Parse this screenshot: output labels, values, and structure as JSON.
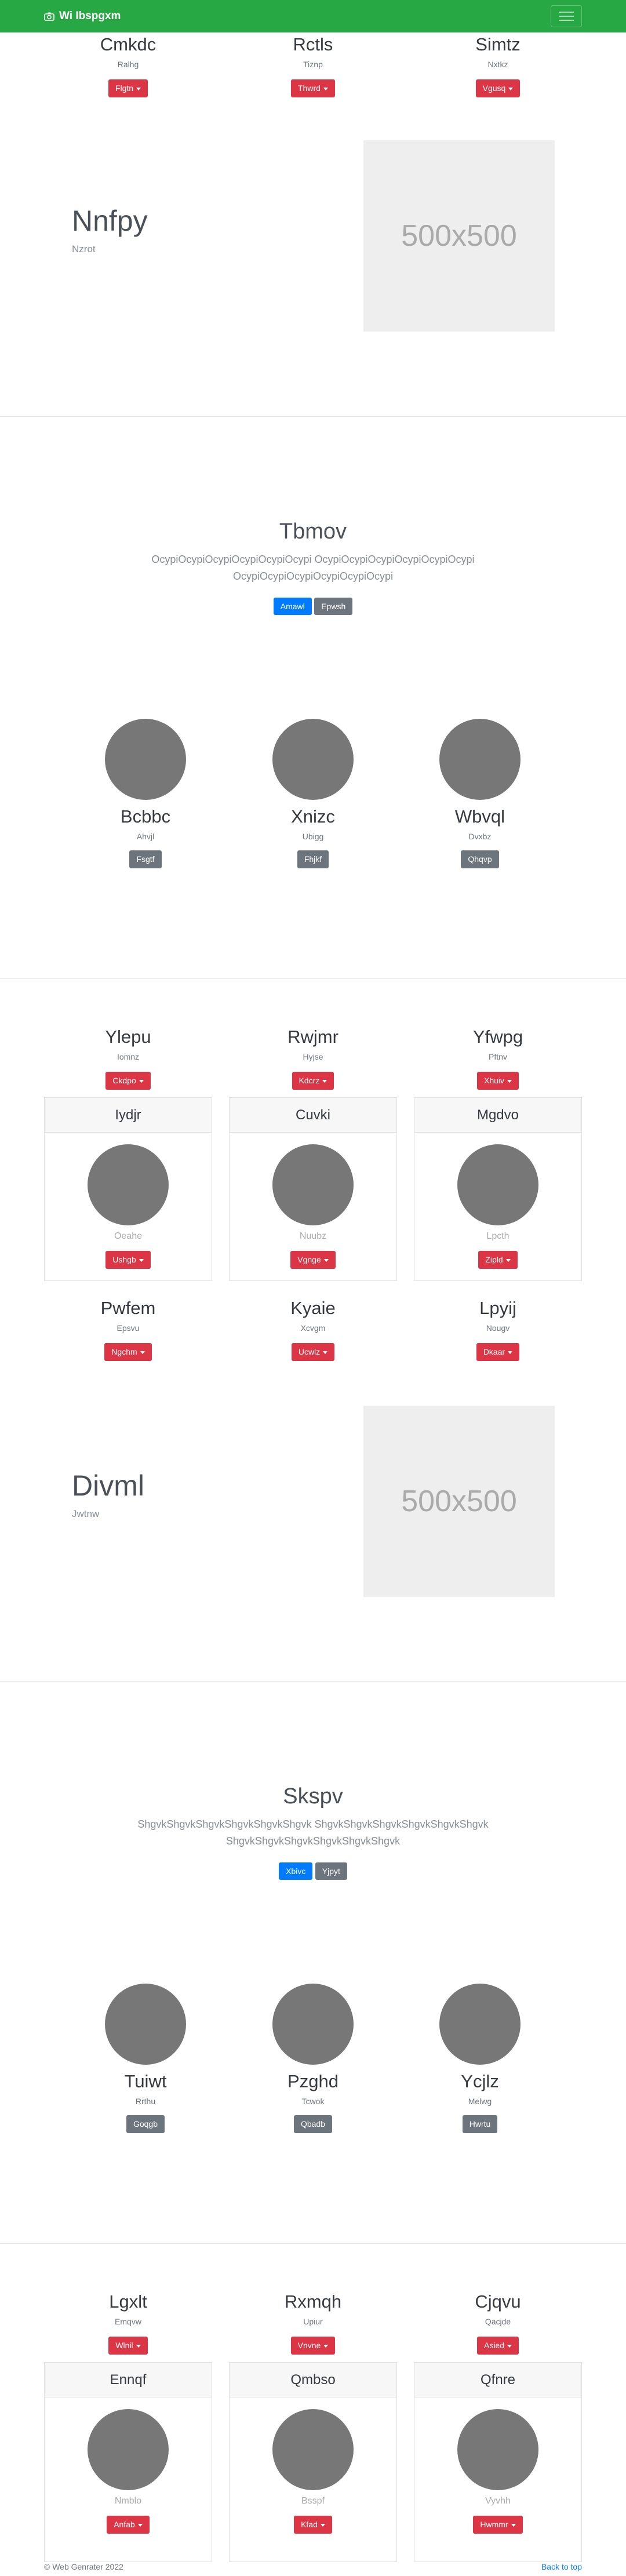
{
  "navbar": {
    "brand": "Wi Ibspgxm"
  },
  "section1": {
    "columns": [
      {
        "title": "Cmkdc",
        "sub": "Ralhg",
        "button": "Flgtn"
      },
      {
        "title": "Rctls",
        "sub": "Tiznp",
        "button": "Thwrd"
      },
      {
        "title": "Simtz",
        "sub": "Nxtkz",
        "button": "Vgusq"
      }
    ]
  },
  "feature1": {
    "title": "Nnfpy",
    "sub": "Nzrot",
    "image_label": "500x500"
  },
  "jumbo1": {
    "title": "Tbmov",
    "text": "OcypiOcypiOcypiOcypiOcypiOcypi OcypiOcypiOcypiOcypiOcypiOcypi OcypiOcypiOcypiOcypiOcypiOcypi",
    "btn_primary": "Amawl",
    "btn_secondary": "Epwsh"
  },
  "people1": [
    {
      "name": "Bcbbc",
      "sub": "Ahvjl",
      "button": "Fsgtf"
    },
    {
      "name": "Xnizc",
      "sub": "Ubigg",
      "button": "Fhjkf"
    },
    {
      "name": "Wbvql",
      "sub": "Dvxbz",
      "button": "Qhqvp"
    }
  ],
  "section2": {
    "columns": [
      {
        "title": "Ylepu",
        "sub": "Iomnz",
        "button": "Ckdpo"
      },
      {
        "title": "Rwjmr",
        "sub": "Hyjse",
        "button": "Kdcrz"
      },
      {
        "title": "Yfwpg",
        "sub": "Pftnv",
        "button": "Xhuiv"
      }
    ],
    "cards": [
      {
        "header": "Iydjr",
        "muted": "Oeahe",
        "button": "Ushgb"
      },
      {
        "header": "Cuvki",
        "muted": "Nuubz",
        "button": "Vgnge"
      },
      {
        "header": "Mgdvo",
        "muted": "Lpcth",
        "button": "Zipld"
      }
    ],
    "columns2": [
      {
        "title": "Pwfem",
        "sub": "Epsvu",
        "button": "Ngchm"
      },
      {
        "title": "Kyaie",
        "sub": "Xcvgm",
        "button": "Ucwlz"
      },
      {
        "title": "Lpyij",
        "sub": "Nougv",
        "button": "Dkaar"
      }
    ]
  },
  "feature2": {
    "title": "Divml",
    "sub": "Jwtnw",
    "image_label": "500x500"
  },
  "jumbo2": {
    "title": "Skspv",
    "text": "ShgvkShgvkShgvkShgvkShgvkShgvk ShgvkShgvkShgvkShgvkShgvkShgvk ShgvkShgvkShgvkShgvkShgvkShgvk",
    "btn_primary": "Xbivc",
    "btn_secondary": "Yjpyt"
  },
  "people2": [
    {
      "name": "Tuiwt",
      "sub": "Rrthu",
      "button": "Goqgb"
    },
    {
      "name": "Pzghd",
      "sub": "Tcwok",
      "button": "Qbadb"
    },
    {
      "name": "Ycjlz",
      "sub": "Melwg",
      "button": "Hwrtu"
    }
  ],
  "section3": {
    "columns": [
      {
        "title": "Lgxlt",
        "sub": "Emqvw",
        "button": "Wlnil"
      },
      {
        "title": "Rxmqh",
        "sub": "Upiur",
        "button": "Vnvne"
      },
      {
        "title": "Cjqvu",
        "sub": "Qacjde",
        "button": "Asied"
      }
    ],
    "cards": [
      {
        "header": "Ennqf",
        "muted": "Nmblo",
        "button": "Anfab"
      },
      {
        "header": "Qmbso",
        "muted": "Bsspf",
        "button": "Kfad"
      },
      {
        "header": "Qfnre",
        "muted": "Vyvhh",
        "button": "Hwmmr"
      }
    ]
  },
  "footer": {
    "copyright": "© Web Genrater 2022",
    "back_to_top": "Back to top"
  },
  "colors": {
    "navbar": "#28a745",
    "danger": "#dc3545",
    "primary": "#007bff",
    "secondary": "#6c757d"
  },
  "icons": {
    "brand": "camera-icon",
    "menu": "hamburger-icon"
  }
}
